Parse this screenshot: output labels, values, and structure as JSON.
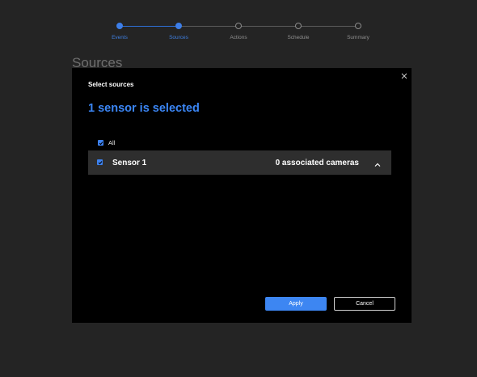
{
  "stepper": {
    "steps": [
      {
        "label": "Events",
        "state": "done"
      },
      {
        "label": "Sources",
        "state": "current"
      },
      {
        "label": "Actions",
        "state": "pending"
      },
      {
        "label": "Schedule",
        "state": "pending"
      },
      {
        "label": "Summary",
        "state": "pending"
      }
    ]
  },
  "page": {
    "title": "Sources"
  },
  "modal": {
    "header": "Select sources",
    "heading": "1 sensor is selected",
    "all_label": "All",
    "all_checked": true,
    "sensors": [
      {
        "name": "Sensor 1",
        "checked": true,
        "associated": "0 associated cameras",
        "expand_icon": "chevron-up-icon"
      }
    ],
    "apply_label": "Apply",
    "cancel_label": "Cancel",
    "close_icon": "close-icon"
  },
  "colors": {
    "accent": "#3d86f2",
    "heading": "#3b86f5",
    "modal_bg": "#000000",
    "page_bg": "#242424",
    "row_bg": "#2e2e2e"
  }
}
